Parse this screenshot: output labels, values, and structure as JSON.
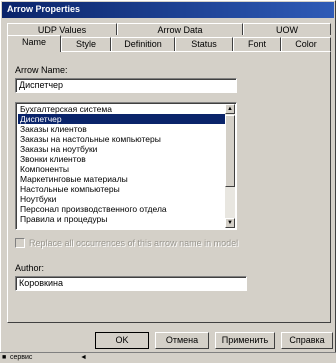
{
  "window": {
    "title": "Arrow Properties"
  },
  "tabs_row1": [
    {
      "label": "UDP Values"
    },
    {
      "label": "Arrow Data"
    },
    {
      "label": "UOW"
    }
  ],
  "tabs_row2": [
    {
      "label": "Name",
      "active": true
    },
    {
      "label": "Style"
    },
    {
      "label": "Definition"
    },
    {
      "label": "Status"
    },
    {
      "label": "Font"
    },
    {
      "label": "Color"
    }
  ],
  "form": {
    "arrow_name_label": "Arrow Name:",
    "arrow_name_value": "Диспетчер",
    "names_list": [
      "Бухгалтерская система",
      "Диспетчер",
      "Заказы клиентов",
      "Заказы на настольные компьютеры",
      "Заказы на ноутбуки",
      "Звонки клиентов",
      "Компоненты",
      "Маркетинговые материалы",
      "Настольные компьютеры",
      "Ноутбуки",
      "Персонал производственного отдела",
      "Правила и процедуры"
    ],
    "selected_index": 1,
    "replace_label": "Replace all occurrences of this arrow name in model",
    "author_label": "Author:",
    "author_value": "Коровкина"
  },
  "buttons": {
    "ok": "OK",
    "cancel": "Отмена",
    "apply": "Применить",
    "help": "Справка"
  },
  "taskbar": {
    "item1": "сервис"
  }
}
